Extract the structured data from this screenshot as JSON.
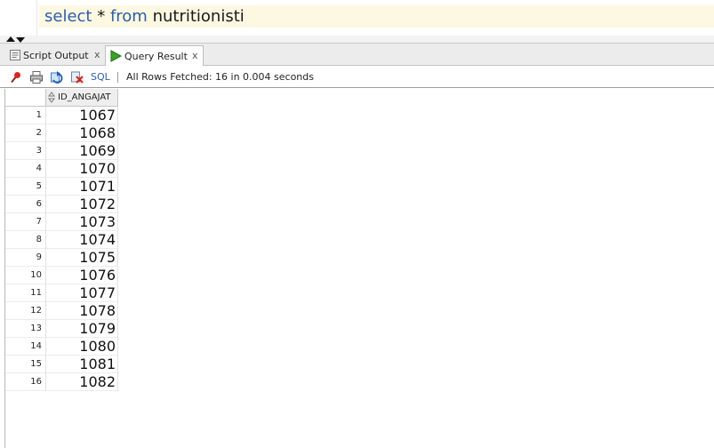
{
  "editor": {
    "keyword_select": "select",
    "star": "*",
    "keyword_from": "from",
    "table": "nutritionisti"
  },
  "tabs": [
    {
      "label": "Script Output",
      "close": "x",
      "active": false,
      "icon": "script-output-icon"
    },
    {
      "label": "Query Result",
      "close": "x",
      "active": true,
      "icon": "play-icon"
    }
  ],
  "toolbar": {
    "sql_label": "SQL",
    "separator": "|",
    "status": "All Rows Fetched: 16 in 0.004 seconds",
    "icons": [
      "pin-icon",
      "print-icon",
      "refresh-icon",
      "delete-icon"
    ]
  },
  "grid": {
    "column": "ID_ANGAJAT",
    "rows": [
      {
        "num": "1",
        "value": "1067"
      },
      {
        "num": "2",
        "value": "1068"
      },
      {
        "num": "3",
        "value": "1069"
      },
      {
        "num": "4",
        "value": "1070"
      },
      {
        "num": "5",
        "value": "1071"
      },
      {
        "num": "6",
        "value": "1072"
      },
      {
        "num": "7",
        "value": "1073"
      },
      {
        "num": "8",
        "value": "1074"
      },
      {
        "num": "9",
        "value": "1075"
      },
      {
        "num": "10",
        "value": "1076"
      },
      {
        "num": "11",
        "value": "1077"
      },
      {
        "num": "12",
        "value": "1078"
      },
      {
        "num": "13",
        "value": "1079"
      },
      {
        "num": "14",
        "value": "1080"
      },
      {
        "num": "15",
        "value": "1081"
      },
      {
        "num": "16",
        "value": "1082"
      }
    ]
  },
  "colors": {
    "keyword": "#2e5fa8",
    "current_line": "#fcf8e2",
    "tab_bar": "#ececec"
  }
}
